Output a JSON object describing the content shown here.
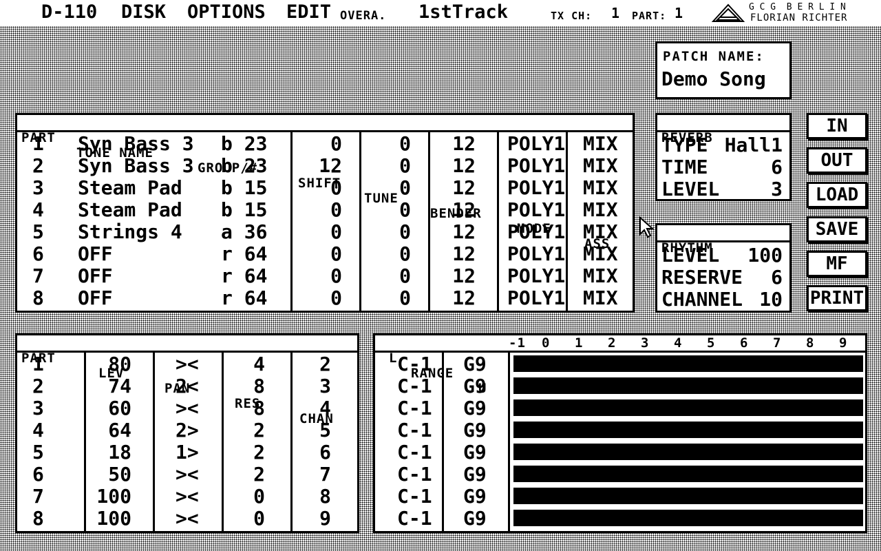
{
  "menu": {
    "items": [
      "D-110",
      "DISK",
      "OPTIONS",
      "EDIT"
    ],
    "mode": "OVERA.",
    "track": "1stTrack",
    "tx_ch_label": "TX CH:",
    "tx_ch_value": "1",
    "part_label": "PART:",
    "part_value": "1",
    "brand_line1": "G C G  B E R L I N",
    "brand_line2": "FLORIAN RICHTER"
  },
  "patch": {
    "label": "PATCH NAME:",
    "name": "Demo Song"
  },
  "parts_table": {
    "headers": [
      "PART",
      "TONE NAME",
      "GROUP/#",
      "SHIFT",
      "TUNE",
      "BENDER",
      "MODE",
      "ASS"
    ],
    "rows": [
      {
        "part": "1",
        "tone": "Syn Bass 3",
        "group": "b 23",
        "shift": "0",
        "tune": "0",
        "bender": "12",
        "mode": "POLY1",
        "ass": "MIX"
      },
      {
        "part": "2",
        "tone": "Syn Bass 3",
        "group": "b 23",
        "shift": "12",
        "tune": "0",
        "bender": "12",
        "mode": "POLY1",
        "ass": "MIX"
      },
      {
        "part": "3",
        "tone": "Steam Pad",
        "group": "b 15",
        "shift": "0",
        "tune": "0",
        "bender": "12",
        "mode": "POLY1",
        "ass": "MIX"
      },
      {
        "part": "4",
        "tone": "Steam Pad",
        "group": "b 15",
        "shift": "0",
        "tune": "0",
        "bender": "12",
        "mode": "POLY1",
        "ass": "MIX"
      },
      {
        "part": "5",
        "tone": "Strings 4",
        "group": "a 36",
        "shift": "0",
        "tune": "0",
        "bender": "12",
        "mode": "POLY1",
        "ass": "MIX"
      },
      {
        "part": "6",
        "tone": "OFF",
        "group": "r 64",
        "shift": "0",
        "tune": "0",
        "bender": "12",
        "mode": "POLY1",
        "ass": "MIX"
      },
      {
        "part": "7",
        "tone": "OFF",
        "group": "r 64",
        "shift": "0",
        "tune": "0",
        "bender": "12",
        "mode": "POLY1",
        "ass": "MIX"
      },
      {
        "part": "8",
        "tone": "OFF",
        "group": "r 64",
        "shift": "0",
        "tune": "0",
        "bender": "12",
        "mode": "POLY1",
        "ass": "MIX"
      }
    ]
  },
  "reverb": {
    "title": "REVERB",
    "type_label": "TYPE",
    "type_value": "Hall1",
    "time_label": "TIME",
    "time_value": "6",
    "level_label": "LEVEL",
    "level_value": "3"
  },
  "rhythm": {
    "title": "RHYTHM",
    "level_label": "LEVEL",
    "level_value": "100",
    "reserve_label": "RESERVE",
    "reserve_value": "6",
    "channel_label": "CHANNEL",
    "channel_value": "10"
  },
  "buttons": [
    "IN",
    "OUT",
    "LOAD",
    "SAVE",
    "MF",
    "PRINT"
  ],
  "mix_table": {
    "headers": [
      "PART",
      "LEV",
      "PAN",
      "RES",
      "CHAN"
    ],
    "rows": [
      {
        "part": "1",
        "lev": "80",
        "pan": "><",
        "res": "4",
        "chan": "2"
      },
      {
        "part": "2",
        "lev": "74",
        "pan": "2<",
        "res": "8",
        "chan": "3"
      },
      {
        "part": "3",
        "lev": "60",
        "pan": "><",
        "res": "8",
        "chan": "4"
      },
      {
        "part": "4",
        "lev": "64",
        "pan": "2>",
        "res": "2",
        "chan": "5"
      },
      {
        "part": "5",
        "lev": "18",
        "pan": "1>",
        "res": "2",
        "chan": "6"
      },
      {
        "part": "6",
        "lev": "50",
        "pan": "><",
        "res": "2",
        "chan": "7"
      },
      {
        "part": "7",
        "lev": "100",
        "pan": "><",
        "res": "0",
        "chan": "8"
      },
      {
        "part": "8",
        "lev": "100",
        "pan": "><",
        "res": "0",
        "chan": "9"
      }
    ]
  },
  "range_table": {
    "header_l": "L",
    "header_range": "RANGE",
    "header_u": "U",
    "octaves": [
      "-1",
      "0",
      "1",
      "2",
      "3",
      "4",
      "5",
      "6",
      "7",
      "8",
      "9"
    ],
    "rows": [
      {
        "low": "C-1",
        "high": "G9"
      },
      {
        "low": "C-1",
        "high": "G9"
      },
      {
        "low": "C-1",
        "high": "G9"
      },
      {
        "low": "C-1",
        "high": "G9"
      },
      {
        "low": "C-1",
        "high": "G9"
      },
      {
        "low": "C-1",
        "high": "G9"
      },
      {
        "low": "C-1",
        "high": "G9"
      },
      {
        "low": "C-1",
        "high": "G9"
      }
    ]
  }
}
